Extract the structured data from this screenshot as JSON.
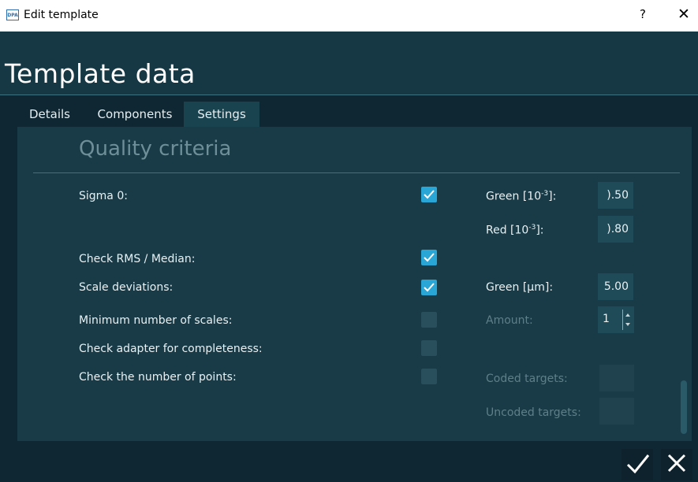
{
  "window": {
    "title": "Edit template",
    "logo": "DPA",
    "help": "?",
    "close": "✕"
  },
  "page_title": "Template data",
  "tabs": [
    {
      "label": "Details"
    },
    {
      "label": "Components"
    },
    {
      "label": "Settings",
      "active": true
    }
  ],
  "section_title": "Quality criteria",
  "rows": [
    {
      "label": "Sigma 0:",
      "checked": true
    },
    {
      "label": "Check RMS / Median:",
      "checked": true
    },
    {
      "label": "Scale deviations:",
      "checked": true
    },
    {
      "label": "Minimum number of scales:",
      "checked": false
    },
    {
      "label": "Check adapter for completeness:",
      "checked": false
    },
    {
      "label": "Check the number of points:",
      "checked": false
    }
  ],
  "fields": {
    "green_label_prefix": "Green [10",
    "green_label_sup": "-3",
    "green_label_suffix": "]:",
    "green_value": ").50",
    "red_label_prefix": "Red [10",
    "red_label_sup": "-3",
    "red_label_suffix": "]:",
    "red_value": ").80",
    "green_um_label": "Green [µm]:",
    "green_um_value": "5.00",
    "amount_label": "Amount:",
    "amount_value": "1",
    "coded_label": "Coded targets:",
    "uncoded_label": "Uncoded targets:"
  },
  "colors": {
    "accent": "#2aa6d6",
    "background": "#0f2733",
    "panel": "#183b47"
  },
  "icons": {
    "ok": "check-icon",
    "cancel": "close-icon"
  }
}
